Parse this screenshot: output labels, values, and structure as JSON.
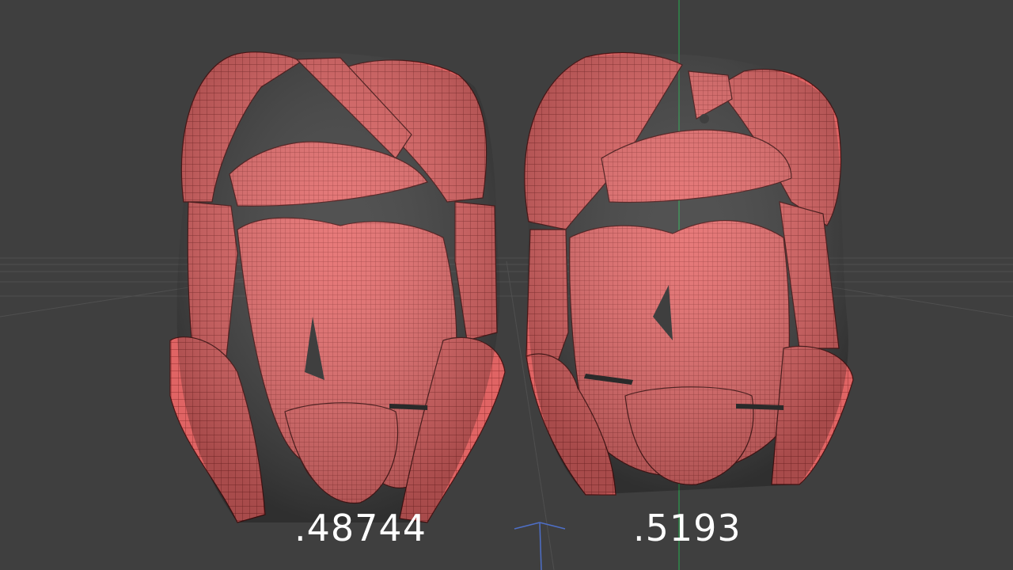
{
  "viewport": {
    "background_color": "#3f3f3f",
    "mesh_color": "#e06464",
    "wire_color": "#7a2020",
    "axis_green": "#2f8a4a",
    "axis_blue": "#4e6fc8"
  },
  "models": [
    {
      "label": ".48744"
    },
    {
      "label": ".5193"
    }
  ]
}
